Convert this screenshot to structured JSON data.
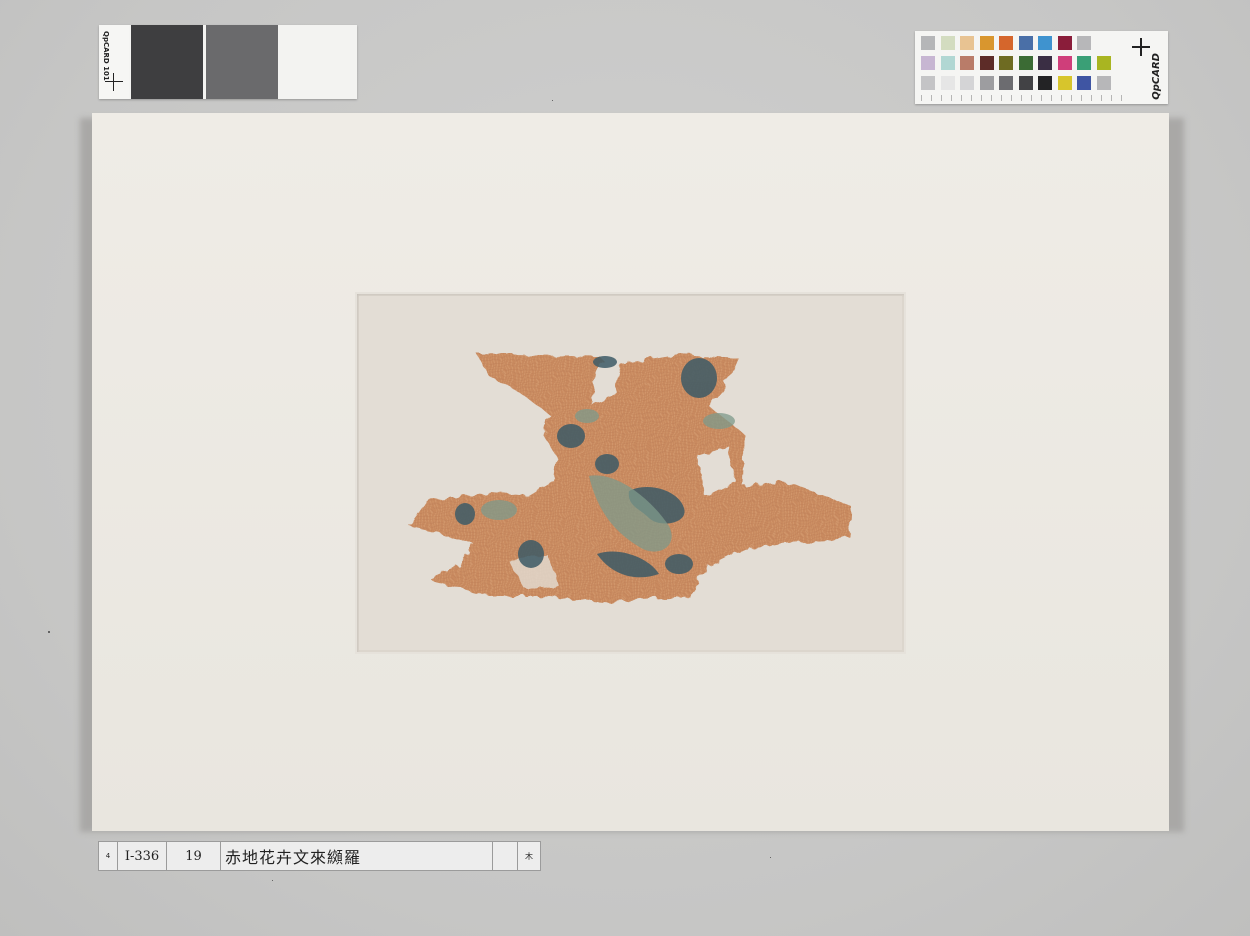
{
  "grey_card": {
    "brand": "QpCARD 101",
    "patch_colors": [
      "#3e3e40",
      "#6a6a6c",
      "#f3f3f1"
    ]
  },
  "color_card": {
    "brand": "QpCARD",
    "swatches": [
      [
        "#b5b6b8",
        "#d3dcc0",
        "#e8c392",
        "#d9962e",
        "#d5662c",
        "#4a6fa7",
        "#3f93cf",
        "#8a1d3a",
        "#b7b7b9"
      ],
      [
        "#c7b6d2",
        "#b1d7d3",
        "#b97c69",
        "#5d2c28",
        "#6e6b22",
        "#3b6b34",
        "#3a2e44",
        "#cf3e7a",
        "#3a9f76",
        "#a9b521"
      ],
      [
        "#c4c4c6",
        "#e6e6e6",
        "#d4d4d6",
        "#9d9da0",
        "#6c6c70",
        "#424245",
        "#232325",
        "#d7c52c",
        "#3f55a3",
        "#b7b7b9"
      ]
    ]
  },
  "artwork": {
    "description_colors": {
      "ground": "#c98a5f",
      "pattern_dark": "#3d5a66",
      "pattern_mid": "#7e9a8b",
      "mat": "#ece9e2"
    }
  },
  "label": {
    "marker": "4",
    "inventory_no": "I-336",
    "item_no": "19",
    "title": "赤地花卉文來纐羅",
    "blank": "",
    "note": "木"
  }
}
